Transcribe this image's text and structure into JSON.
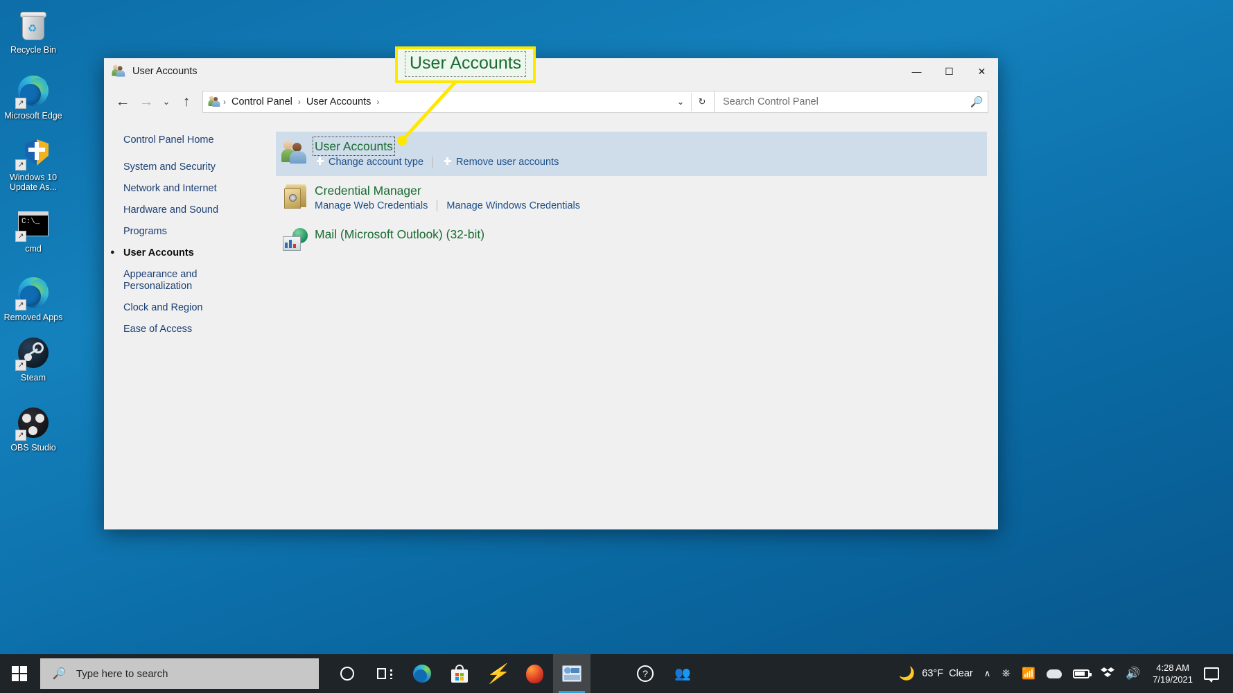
{
  "desktop": {
    "icons": [
      {
        "label": "Recycle Bin",
        "icon": "recycle-bin-icon",
        "shortcut": false
      },
      {
        "label": "Microsoft Edge",
        "icon": "microsoft-edge-icon",
        "shortcut": true
      },
      {
        "label": "Windows 10 Update As...",
        "icon": "windows-update-shield-icon",
        "shortcut": true
      },
      {
        "label": "cmd",
        "icon": "command-prompt-icon",
        "shortcut": true
      },
      {
        "label": "Removed Apps",
        "icon": "microsoft-edge-icon",
        "shortcut": true
      },
      {
        "label": "Steam",
        "icon": "steam-icon",
        "shortcut": true
      },
      {
        "label": "OBS Studio",
        "icon": "obs-studio-icon",
        "shortcut": true
      }
    ]
  },
  "window": {
    "title": "User Accounts",
    "title_icon": "user-accounts-icon",
    "controls": {
      "minimize": "—",
      "maximize": "☐",
      "close": "✕"
    },
    "nav": {
      "back": "←",
      "forward": "→",
      "recent": "⌄",
      "up": "↑"
    },
    "address": {
      "icon": "user-accounts-icon",
      "crumbs": [
        "Control Panel",
        "User Accounts"
      ],
      "separator": "›",
      "trailing_separator": "›",
      "dropdown": "⌄",
      "refresh": "↻"
    },
    "search": {
      "placeholder": "Search Control Panel",
      "icon": "search-icon",
      "value": ""
    }
  },
  "sidebar": {
    "home": "Control Panel Home",
    "items": [
      {
        "label": "System and Security",
        "current": false
      },
      {
        "label": "Network and Internet",
        "current": false
      },
      {
        "label": "Hardware and Sound",
        "current": false
      },
      {
        "label": "Programs",
        "current": false
      },
      {
        "label": "User Accounts",
        "current": true
      },
      {
        "label": "Appearance and Personalization",
        "current": false
      },
      {
        "label": "Clock and Region",
        "current": false
      },
      {
        "label": "Ease of Access",
        "current": false
      }
    ]
  },
  "content": {
    "items": [
      {
        "title": "User Accounts",
        "icon": "user-accounts-icon",
        "selected": true,
        "focused": true,
        "links": [
          {
            "label": "Change account type",
            "shield": true
          },
          {
            "label": "Remove user accounts",
            "shield": true
          }
        ]
      },
      {
        "title": "Credential Manager",
        "icon": "credential-vault-icon",
        "selected": false,
        "focused": false,
        "links": [
          {
            "label": "Manage Web Credentials",
            "shield": false
          },
          {
            "label": "Manage Windows Credentials",
            "shield": false
          }
        ]
      },
      {
        "title": "Mail (Microsoft Outlook) (32-bit)",
        "icon": "mail-outlook-icon",
        "selected": false,
        "focused": false,
        "links": []
      }
    ]
  },
  "callout": {
    "text": "User Accounts",
    "border_color": "#ffe800",
    "text_color": "#1a6b33"
  },
  "taskbar": {
    "start": "start-button",
    "search_placeholder": "Type here to search",
    "search_icon": "search-icon",
    "items": [
      {
        "name": "cortana-icon",
        "active": false
      },
      {
        "name": "task-view-icon",
        "active": false
      },
      {
        "name": "microsoft-edge-icon",
        "active": false
      },
      {
        "name": "microsoft-store-icon",
        "active": false
      },
      {
        "name": "lightning-app-icon",
        "active": false
      },
      {
        "name": "firefox-icon",
        "active": false
      },
      {
        "name": "control-panel-icon",
        "active": true
      },
      {
        "name": "help-icon",
        "active": false
      },
      {
        "name": "people-icon",
        "active": false
      }
    ],
    "tray": {
      "weather_icon": "moon-icon",
      "temperature": "63°F",
      "condition": "Clear",
      "overflow": "∧",
      "icons": [
        "screen-rotation-icon",
        "wifi-icon",
        "onedrive-icon",
        "battery-icon",
        "dropbox-icon",
        "volume-icon"
      ],
      "time": "4:28 AM",
      "date": "7/19/2021",
      "action_center": "notifications-icon"
    }
  }
}
